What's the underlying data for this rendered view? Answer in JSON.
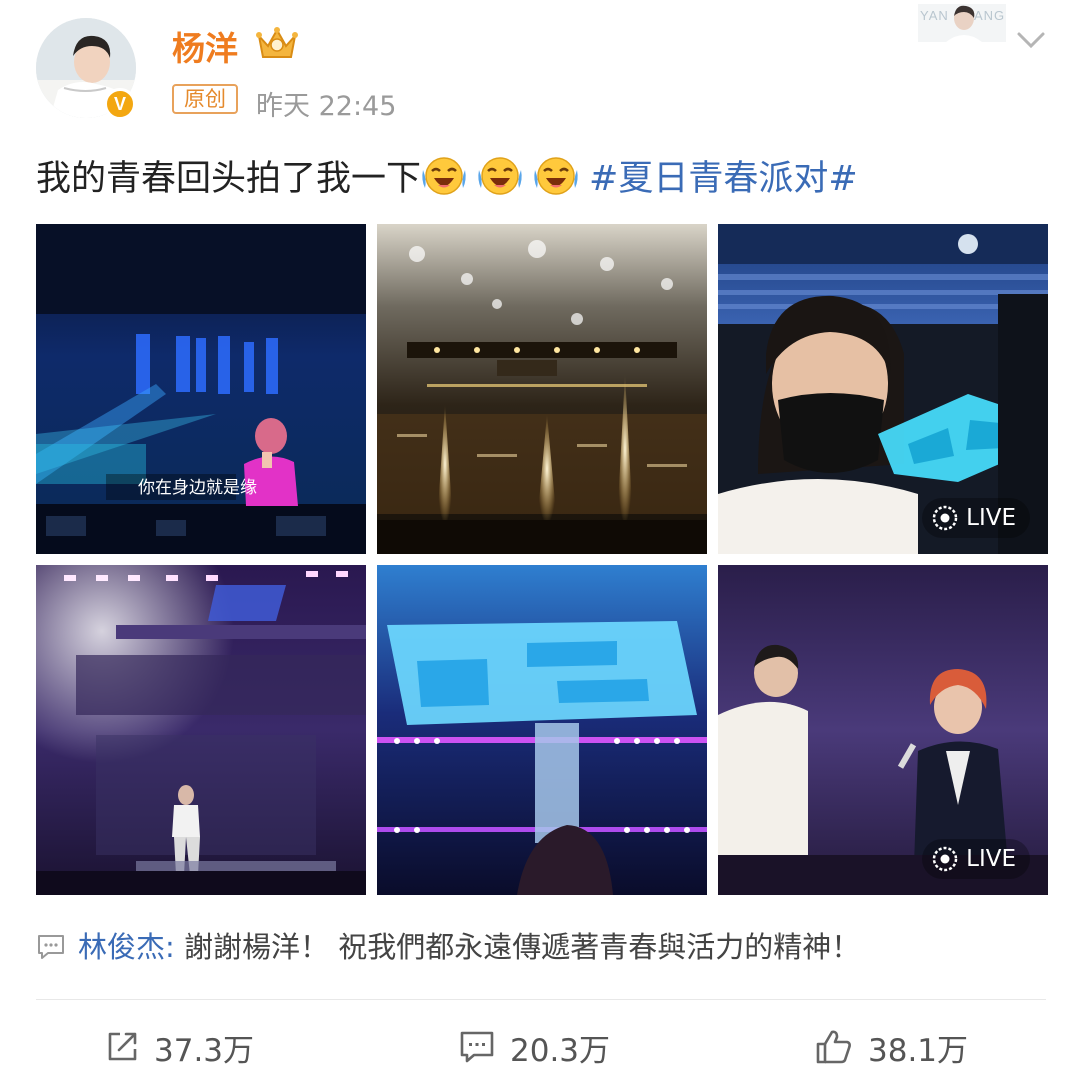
{
  "author": {
    "name": "杨洋",
    "badge": "原创",
    "time": "昨天 22:45",
    "banner_text_left": "YAN",
    "banner_text_right": "ANG",
    "name_color": "#ef7c1f",
    "verified_color": "#f3a711",
    "verified_mark": "V"
  },
  "post": {
    "text": "我的青春回头拍了我一下",
    "emojis": [
      "laugh-cry-emoji",
      "laugh-cry-emoji",
      "laugh-cry-emoji"
    ],
    "hashtag": "#夏日青春派对#",
    "hashtag_color": "#3a6bb6"
  },
  "images": [
    {
      "subtitle": "你在身边就是缘",
      "live": false
    },
    {
      "live": false
    },
    {
      "live": true,
      "badge": "LIVE"
    },
    {
      "live": false
    },
    {
      "live": false
    },
    {
      "live": true,
      "badge": "LIVE"
    }
  ],
  "comment": {
    "icon": "comment-icon",
    "author": "林俊杰",
    "separator": ":",
    "text": " 謝謝楊洋！ 祝我們都永遠傳遞著青春與活力的精神！"
  },
  "actions": {
    "repost": {
      "icon": "repost-icon",
      "count": "37.3万"
    },
    "comment": {
      "icon": "comment-icon",
      "count": "20.3万"
    },
    "like": {
      "icon": "like-icon",
      "count": "38.1万"
    }
  }
}
